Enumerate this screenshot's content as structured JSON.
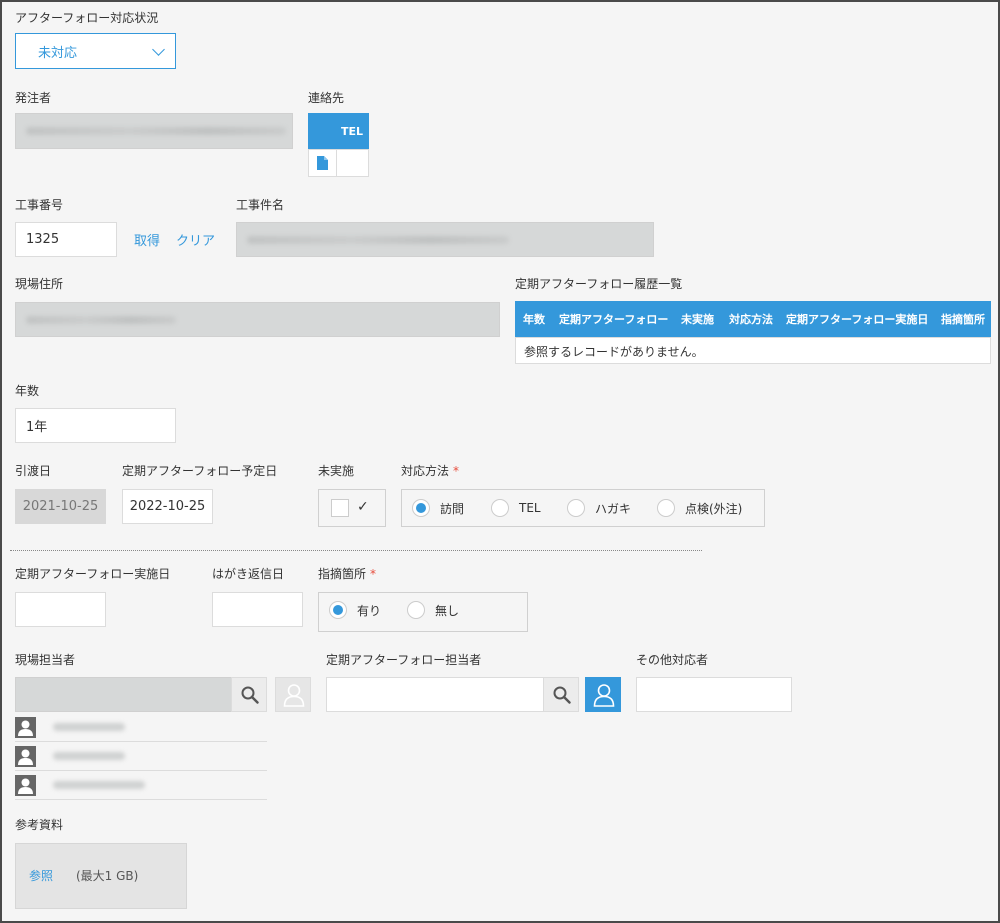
{
  "after_follow": {
    "label": "アフターフォロー対応状況",
    "value": "未対応"
  },
  "orderer": {
    "label": "発注者"
  },
  "contact": {
    "label": "連絡先",
    "col_header": "TEL"
  },
  "work_no": {
    "label": "工事番号",
    "value": "1325",
    "get_link": "取得",
    "clear_link": "クリア"
  },
  "work_name": {
    "label": "工事件名"
  },
  "site_address": {
    "label": "現場住所"
  },
  "history": {
    "label": "定期アフターフォロー履歴一覧",
    "columns": [
      "年数",
      "定期アフターフォロー",
      "未実施",
      "対応方法",
      "定期アフターフォロー実施日",
      "指摘箇所"
    ],
    "empty_text": "参照するレコードがありません。"
  },
  "years": {
    "label": "年数",
    "value": "1年"
  },
  "handover": {
    "label": "引渡日",
    "value": "2021-10-25"
  },
  "planned": {
    "label": "定期アフターフォロー予定日",
    "value": "2022-10-25"
  },
  "not_done": {
    "label": "未実施",
    "check_mark": "✓"
  },
  "method": {
    "label": "対応方法",
    "required": "*",
    "options": [
      "訪問",
      "TEL",
      "ハガキ",
      "点検(外注)"
    ],
    "selected": "訪問"
  },
  "done_date": {
    "label": "定期アフターフォロー実施日"
  },
  "postcard_date": {
    "label": "はがき返信日"
  },
  "issue": {
    "label": "指摘箇所",
    "required": "*",
    "options": [
      "有り",
      "無し"
    ],
    "selected": "有り"
  },
  "site_staff": {
    "label": "現場担当者"
  },
  "follow_staff": {
    "label": "定期アフターフォロー担当者"
  },
  "other_staff": {
    "label": "その他対応者"
  },
  "reference": {
    "label": "参考資料",
    "browse": "参照",
    "max": "(最大1 GB)"
  },
  "colors": {
    "accent": "#3498db",
    "required": "#e74c3c"
  }
}
